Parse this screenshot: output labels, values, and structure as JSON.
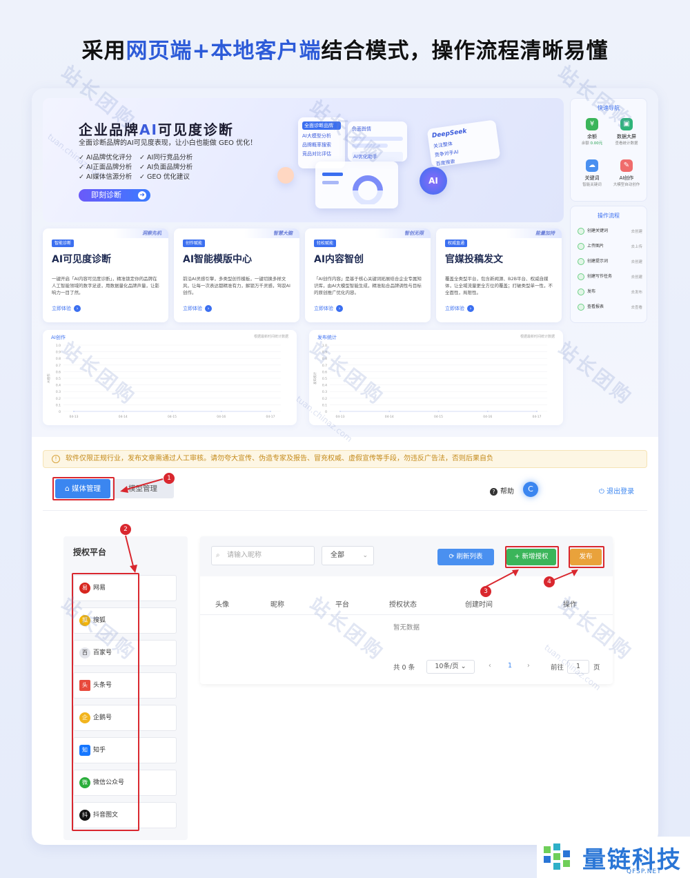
{
  "headline": {
    "part1": "采用",
    "highlight1": "网页端+本地客户端",
    "part2": "结合模式，操作流程清晰易懂"
  },
  "hero": {
    "title_pre": "企业品牌",
    "title_ai": "AI",
    "title_post": "可见度诊断",
    "subtitle": "全面诊断品牌的AI可见度表现，让小白也能做 GEO 优化！",
    "features": [
      "AI品牌优化评分",
      "AI同行竞品分析",
      "AI正面品牌分析",
      "AI负面品牌分析",
      "AI媒体信源分析",
      "GEO 优化建议"
    ],
    "cta": "即刻诊断",
    "mock_labels": [
      "全面诊断品牌",
      "AI大模型分析",
      "品牌概率搜索",
      "竞品对比评估",
      "负面舆情",
      "AI优化助手",
      "DeepSeek",
      "关注整体",
      "竞争对手AI",
      "百度搜索"
    ]
  },
  "quick_nav": {
    "title": "快速导航",
    "items": [
      {
        "label": "余额",
        "value": "0.00元",
        "note": "余额"
      },
      {
        "label": "数据大屏",
        "note": "查看统计数据"
      },
      {
        "label": "关键词",
        "note": "智能关键词"
      },
      {
        "label": "AI创作",
        "note": "大模型自动创作"
      }
    ]
  },
  "flow": {
    "title": "操作流程",
    "steps": [
      {
        "label": "创建关键词",
        "status": "去创建"
      },
      {
        "label": "上传图片",
        "status": "去上传"
      },
      {
        "label": "创建提示词",
        "status": "去创建"
      },
      {
        "label": "创建写作任务",
        "status": "去创建"
      },
      {
        "label": "发布",
        "status": "去发布"
      },
      {
        "label": "查看报表",
        "status": "去查看"
      }
    ]
  },
  "cards": [
    {
      "tag": "智能诊断",
      "badge": "洞察先机",
      "title": "AI可见度诊断",
      "desc": "一键开启「AI内容可见度诊断」，精准锁定你的品牌在人工智能领域的数字足迹，用数据量化品牌声量，让影响力一目了然。",
      "link": "立即体验"
    },
    {
      "tag": "创作赋能",
      "badge": "智慧大脑",
      "title": "AI智能模版中心",
      "desc": "前沿AI灵感引擎，多类型创作模板，一键切换多样文风，让每一次表达都精准有力，解锁万千灵感，驾驭AI创作。",
      "link": "立即体验"
    },
    {
      "tag": "轻松赋能",
      "badge": "智创无限",
      "title": "AI内容智创",
      "desc": "「AI创作内容」是基于核心关键词拓展结合企业专属知识库，由AI大模型智能生成，精准贴合品牌调性与目标的原创推广优化内容。",
      "link": "立即体验"
    },
    {
      "tag": "权威直通",
      "badge": "能量加持",
      "title": "官媒投稿发文",
      "desc": "覆盖全类型平台，包含新闻源、B2B平台、权威自媒体，让全域流量更全方位的覆盖；打破类型单一性，不全面性，局限性。",
      "link": "立即体验"
    }
  ],
  "charts_text": [
    {
      "title": "AI创作",
      "hint": "根据最新时间统计数据",
      "ylabel": "AI创作"
    },
    {
      "title": "发布统计",
      "hint": "根据最新时间统计数据",
      "ylabel": "发布统计"
    }
  ],
  "chart_data": [
    {
      "type": "line",
      "title": "AI创作",
      "x": [
        "04-13",
        "04-14",
        "04-15",
        "04-16",
        "04-17"
      ],
      "yticks": [
        "1.0",
        "0.9",
        "0.8",
        "0.7",
        "0.6",
        "0.5",
        "0.4",
        "0.3",
        "0.2",
        "0.1",
        "0"
      ],
      "series": [
        {
          "values": [
            0,
            0,
            0,
            0,
            0
          ]
        }
      ],
      "ylim": [
        0,
        1.0
      ]
    },
    {
      "type": "line",
      "title": "发布统计",
      "x": [
        "04-13",
        "04-14",
        "04-15",
        "04-16",
        "04-17"
      ],
      "yticks": [
        "1.0",
        "0.9",
        "0.8",
        "0.7",
        "0.6",
        "0.5",
        "0.4",
        "0.3",
        "0.2",
        "0.1",
        "0"
      ],
      "series": [
        {
          "values": [
            0,
            0,
            0,
            0,
            0
          ]
        }
      ],
      "ylim": [
        0,
        1.0
      ]
    }
  ],
  "notice": "软件仅限正规行业，发布文章需通过人工审核。请勿夸大宣传、伪造专家及报告、冒充权威、虚假宣传等手段，勿违反广告法，否则后果自负",
  "tabs": {
    "media": "媒体管理",
    "model": "模型管理"
  },
  "header": {
    "help": "帮助",
    "avatar": "C",
    "logout": "退出登录"
  },
  "annotations": [
    "1",
    "2",
    "3",
    "4"
  ],
  "sidebar": {
    "title": "授权平台",
    "platforms": [
      {
        "name": "网易",
        "color": "#d7261e",
        "glyph": "易"
      },
      {
        "name": "搜狐",
        "color": "#f5b400",
        "glyph": "狐"
      },
      {
        "name": "百家号",
        "color": "#e4e6ec",
        "glyph": "百"
      },
      {
        "name": "头条号",
        "color": "#e84a3c",
        "glyph": "头"
      },
      {
        "name": "企鹅号",
        "color": "#f2b41d",
        "glyph": "企"
      },
      {
        "name": "知乎",
        "color": "#1677ff",
        "glyph": "知"
      },
      {
        "name": "微信公众号",
        "color": "#2aae3b",
        "glyph": "微"
      },
      {
        "name": "抖音图文",
        "color": "#111111",
        "glyph": "抖"
      }
    ]
  },
  "main": {
    "search_placeholder": "请输入昵称",
    "select_value": "全部",
    "btn_refresh": "刷新列表",
    "btn_add": "+ 新增授权",
    "btn_publish": "发布",
    "columns": [
      "头像",
      "昵称",
      "平台",
      "授权状态",
      "创建时间",
      "操作"
    ],
    "empty": "暂无数据",
    "pager": {
      "total": "共 0 条",
      "size": "10条/页",
      "prev": "‹",
      "page": "1",
      "next": "›",
      "goto": "前往",
      "goto_page": "1",
      "unit": "页"
    }
  },
  "watermark": {
    "text": "站长团购",
    "sub": "tuan.chinaz.com"
  },
  "brand": {
    "name": "量链科技",
    "url": "QFSP.NET"
  },
  "colors": {
    "accent": "#3b6ff0",
    "red_annotation": "#d9272e",
    "green": "#3bb55a",
    "orange": "#e9a23b"
  }
}
